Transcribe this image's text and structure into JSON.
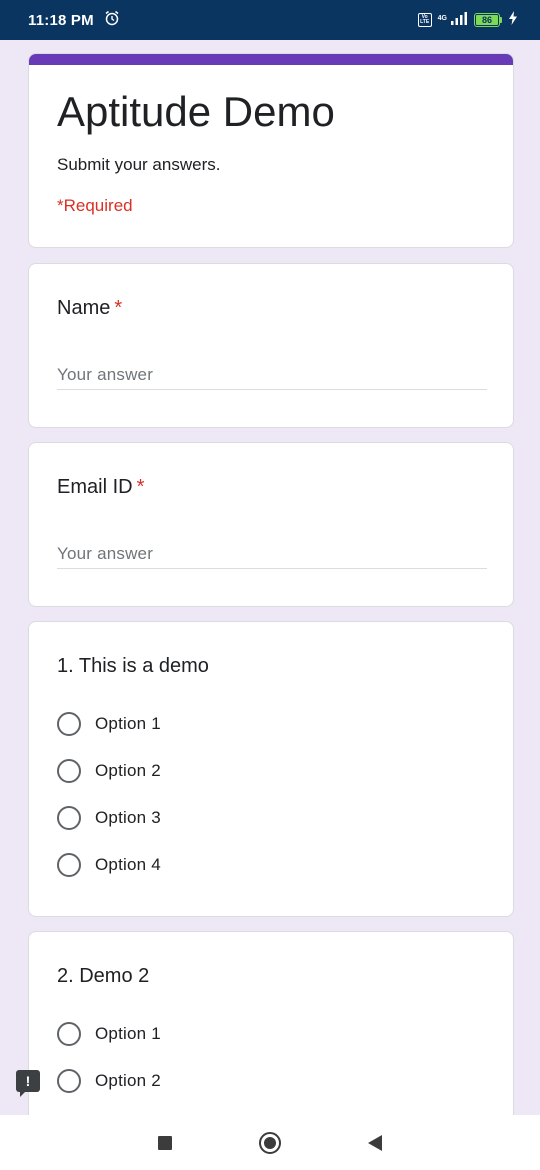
{
  "status_bar": {
    "time": "11:18 PM",
    "alarm_icon": "alarm-clock-icon",
    "volte_top": "Vo",
    "volte_bottom": "LTE",
    "network": "4G",
    "signal_icon": "signal-bars-icon",
    "battery": "86",
    "charging_icon": "lightning-bolt-icon"
  },
  "form": {
    "accent_color": "#673ab7",
    "title": "Aptitude Demo",
    "description": "Submit your answers.",
    "required_note": "*Required"
  },
  "questions": [
    {
      "title": "Name",
      "required_mark": "*",
      "placeholder": "Your answer"
    },
    {
      "title": "Email ID",
      "required_mark": "*",
      "placeholder": "Your answer"
    },
    {
      "title": "1. This is a demo",
      "options": [
        "Option 1",
        "Option 2",
        "Option 3",
        "Option 4"
      ]
    },
    {
      "title": "2. Demo 2",
      "options": [
        "Option 1",
        "Option 2"
      ]
    }
  ],
  "feedback": {
    "icon": "report-feedback-icon",
    "glyph": "!"
  },
  "nav_bar": {
    "recents_icon": "square-recents-icon",
    "home_icon": "circle-home-icon",
    "back_icon": "triangle-back-icon"
  }
}
